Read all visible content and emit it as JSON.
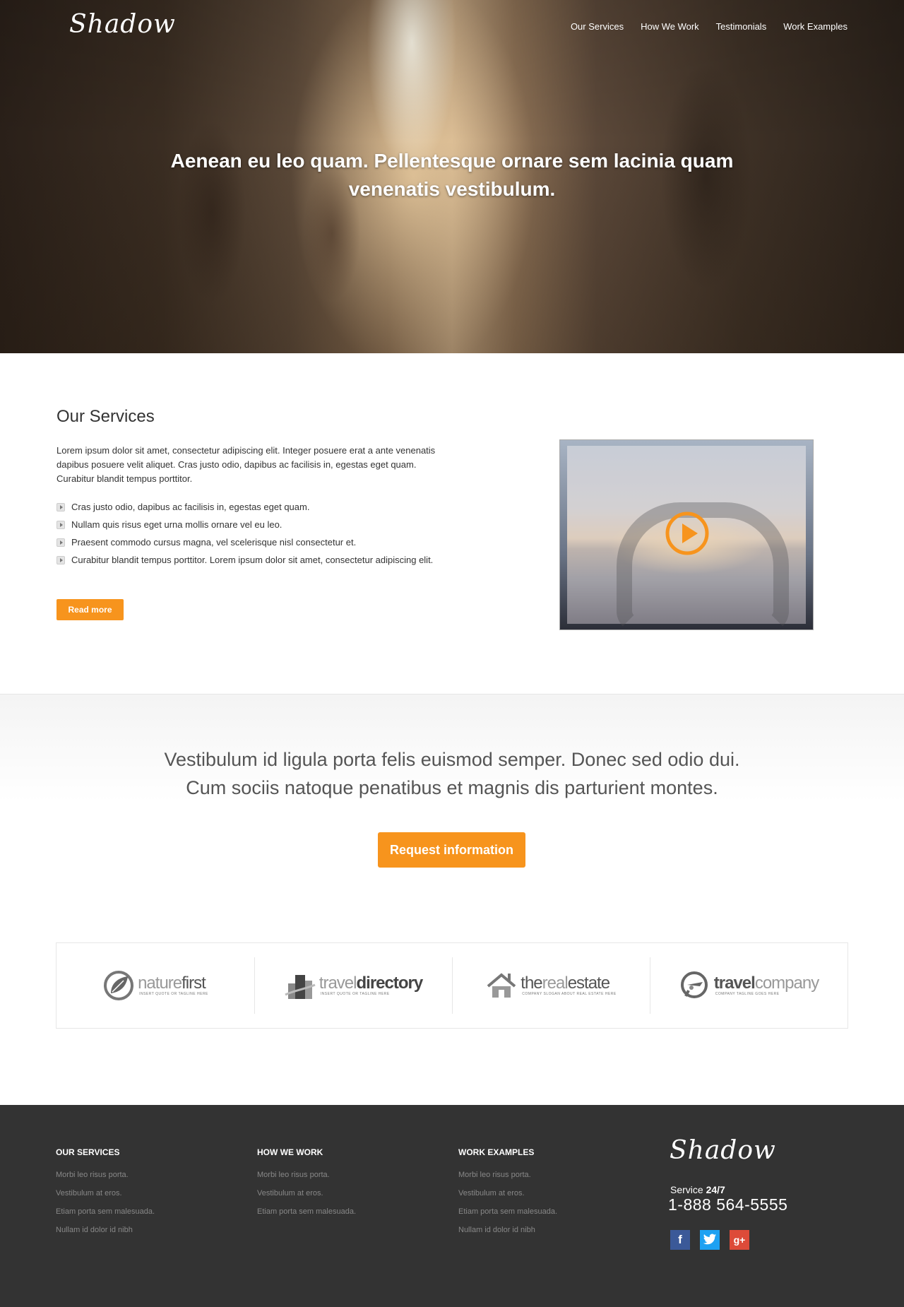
{
  "brand": {
    "logo_text": "Shadow"
  },
  "nav": {
    "items": [
      {
        "label": "Our Services"
      },
      {
        "label": "How We Work"
      },
      {
        "label": "Testimonials"
      },
      {
        "label": "Work Examples"
      }
    ]
  },
  "hero": {
    "title": "Aenean eu leo quam. Pellentesque ornare sem lacinia quam venenatis vestibulum."
  },
  "services": {
    "title": "Our Services",
    "paragraph": "Lorem ipsum dolor sit amet, consectetur adipiscing elit. Integer posuere erat a ante venenatis dapibus posuere velit aliquet. Cras justo odio, dapibus ac facilisis in, egestas eget quam. Curabitur blandit tempus porttitor.",
    "features": [
      "Cras justo odio, dapibus ac facilisis in, egestas eget quam.",
      "Nullam quis risus eget urna mollis ornare vel eu leo.",
      "Praesent commodo cursus magna, vel scelerisque nisl consectetur et.",
      "Curabitur blandit tempus porttitor. Lorem ipsum dolor sit amet, consectetur adipiscing elit."
    ],
    "read_more_label": "Read more"
  },
  "cta": {
    "text_line1": "Vestibulum id ligula porta felis euismod semper. Donec sed odio dui.",
    "text_line2": "Cum sociis natoque penatibus et magnis dis parturient montes.",
    "button_label": "Request information"
  },
  "clients": [
    {
      "name_lite": "nature",
      "name_bold": "first",
      "tagline": "INSERT QUOTE OR TAGLINE HERE",
      "icon": "leaf-icon"
    },
    {
      "name_lite": "travel",
      "name_bold": "directory",
      "tagline": "INSERT QUOTE OR TAGLINE HERE",
      "icon": "buildings-icon"
    },
    {
      "name_lite": "the",
      "name_mid": "real",
      "name_bold": "estate",
      "tagline": "COMPANY SLOGAN ABOUT REAL ESTATE HERE",
      "icon": "house-icon"
    },
    {
      "name_lite": "travel",
      "name_bold": "company",
      "tagline": "COMPANY TAGLINE GOES HERE",
      "icon": "plane-bubble-icon"
    }
  ],
  "footer": {
    "columns": [
      {
        "title": "OUR SERVICES",
        "items": [
          "Morbi leo risus porta.",
          "Vestibulum at eros.",
          " Etiam porta sem malesuada.",
          "Nullam id dolor id nibh"
        ]
      },
      {
        "title": "HOW WE WORK",
        "items": [
          "Morbi leo risus porta.",
          "Vestibulum at eros.",
          " Etiam porta sem malesuada."
        ]
      },
      {
        "title": "WORK EXAMPLES",
        "items": [
          "Morbi leo risus porta.",
          "Vestibulum at eros.",
          " Etiam porta sem malesuada.",
          "Nullam id dolor id nibh"
        ]
      }
    ],
    "service_label": "Service ",
    "service_hours": "24/7",
    "phone": "1-888 564-5555",
    "socials": [
      {
        "name": "facebook-icon",
        "glyph": "f",
        "color": "#3b5998"
      },
      {
        "name": "twitter-icon",
        "glyph": "t",
        "color": "#1da1f2"
      },
      {
        "name": "google-plus-icon",
        "glyph": "g+",
        "color": "#dd4b39"
      }
    ]
  },
  "colors": {
    "accent": "#f7941d",
    "footer_bg": "#333333"
  }
}
